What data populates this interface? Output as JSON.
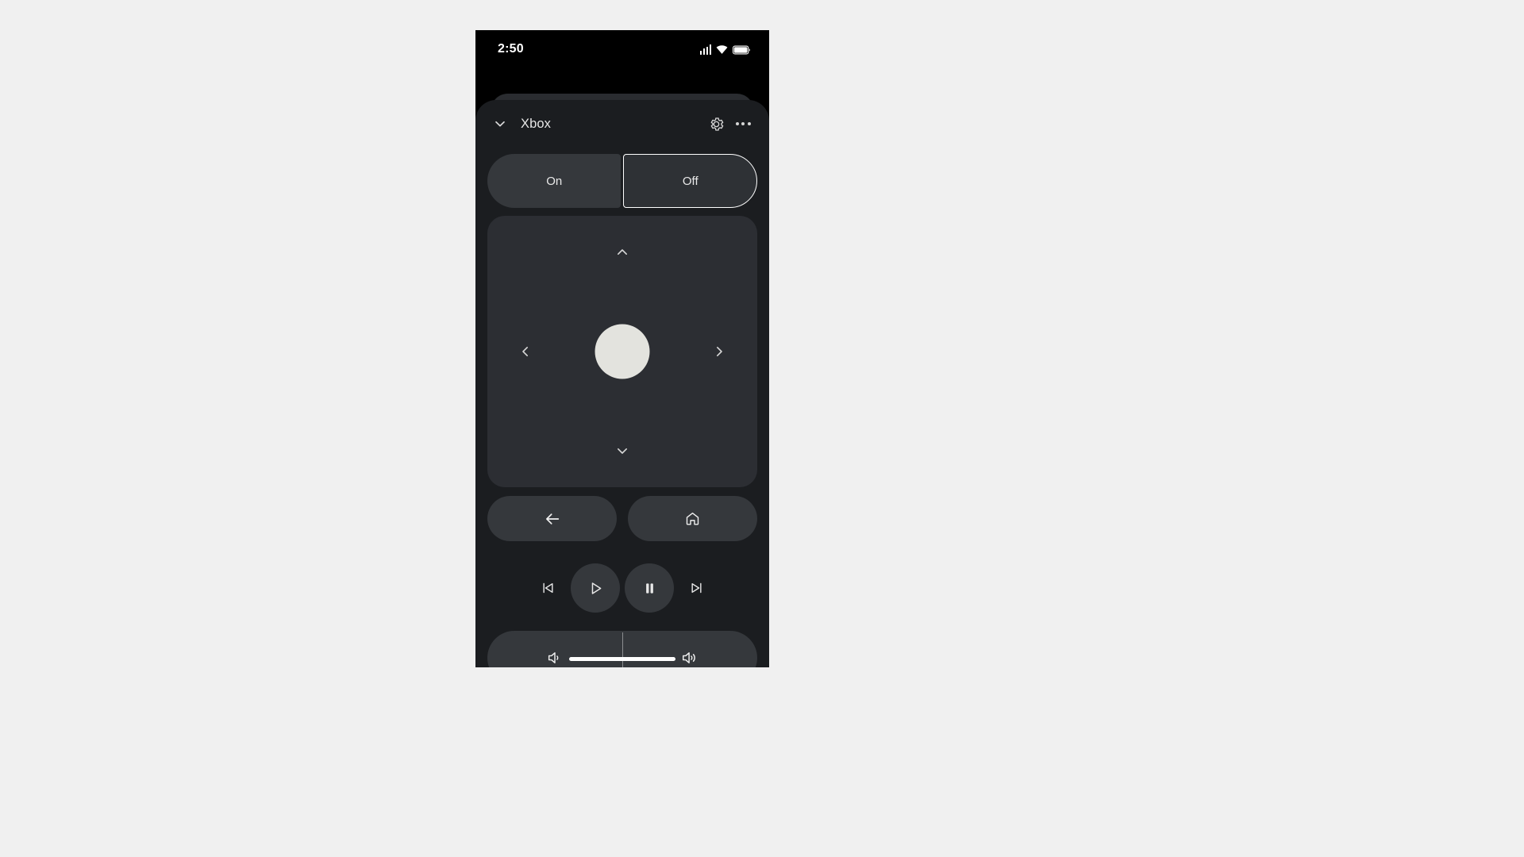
{
  "canvas": {
    "background": "#f0f0f0"
  },
  "phone": {
    "statusbar": {
      "time": "2:50",
      "icons": [
        "signal-icon",
        "wifi-icon",
        "battery-icon"
      ]
    },
    "header": {
      "collapse_icon": "chevron-down-icon",
      "title": "Xbox",
      "settings_icon": "gear-icon",
      "overflow_icon": "more-horizontal-icon"
    },
    "power_toggle": {
      "options": [
        {
          "label": "On",
          "selected": false
        },
        {
          "label": "Off",
          "selected": true
        }
      ],
      "selected_value": "Off",
      "selected_outline_color": "#ffffff"
    },
    "dpad": {
      "up_icon": "chevron-up-icon",
      "left_icon": "chevron-left-icon",
      "right_icon": "chevron-right-icon",
      "down_icon": "chevron-down-icon",
      "ok_button": "dpad-center-ok",
      "ok_color": "#e3e3de",
      "panel_color": "#2c2e33"
    },
    "nav": [
      {
        "name": "back-button",
        "icon": "arrow-left-icon"
      },
      {
        "name": "home-button",
        "icon": "home-icon"
      }
    ],
    "media_controls": [
      {
        "name": "previous-button",
        "icon": "skip-previous-icon",
        "style": "flat"
      },
      {
        "name": "play-button",
        "icon": "play-icon",
        "style": "round"
      },
      {
        "name": "pause-button",
        "icon": "pause-icon",
        "style": "round"
      },
      {
        "name": "next-button",
        "icon": "skip-next-icon",
        "style": "flat"
      }
    ],
    "volume": [
      {
        "name": "volume-down-button",
        "icon": "volume-down-icon"
      },
      {
        "name": "volume-up-button",
        "icon": "volume-up-icon"
      }
    ],
    "home_indicator": "home-indicator-bar",
    "colors": {
      "sheet": "#1b1d20",
      "control": "#35383c",
      "status_bar": "#000000",
      "text": "#e6e6e6"
    }
  }
}
